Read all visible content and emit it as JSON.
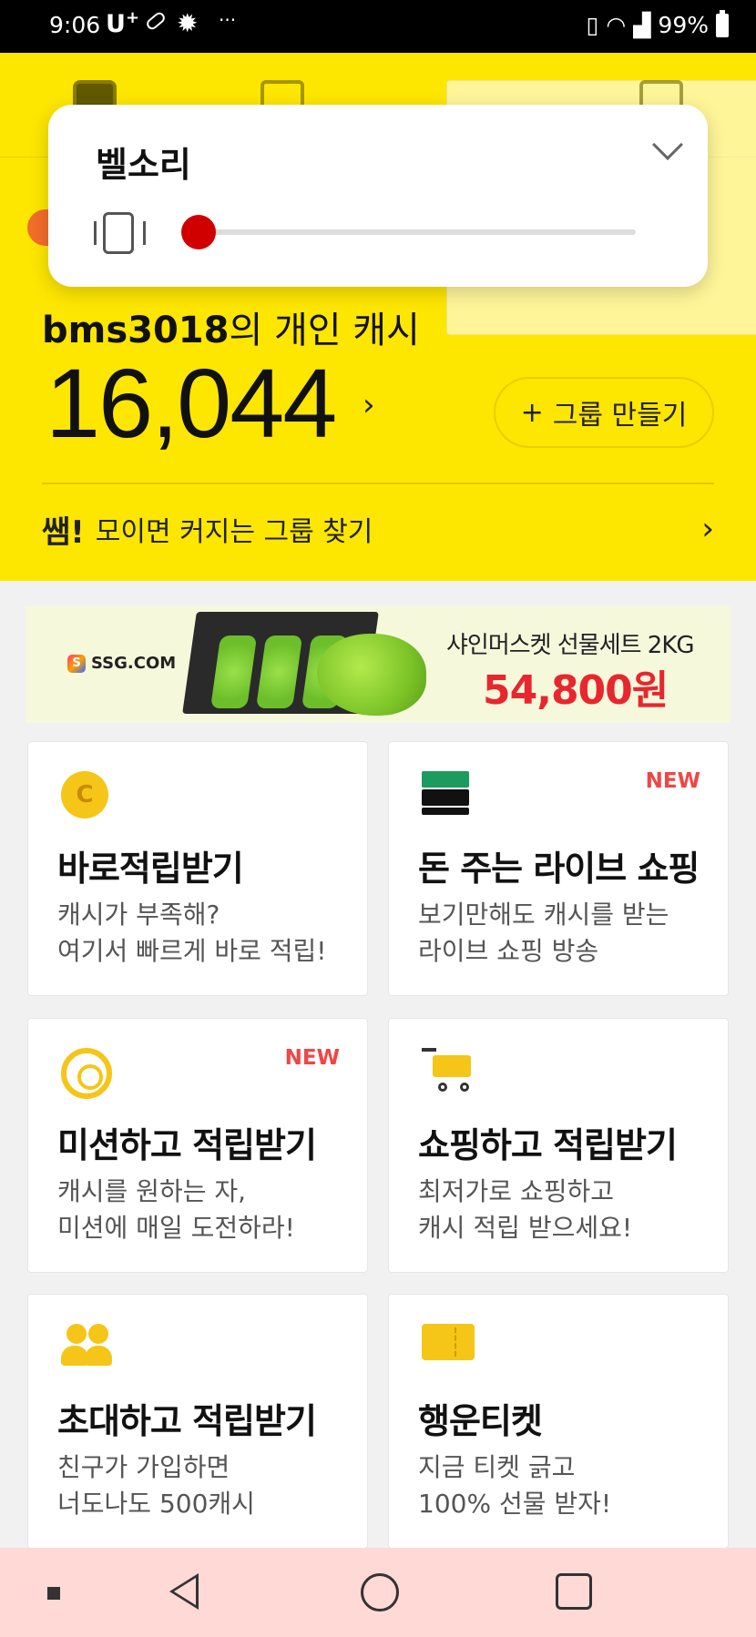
{
  "status_bar": {
    "time": "9:06",
    "carrier": "U",
    "carrier_sup": "+",
    "more": "···",
    "battery": "99%"
  },
  "tabs": [
    {
      "icon": "home-icon"
    },
    {
      "icon": "shopping-bag-icon"
    },
    {
      "icon": "card-icon"
    },
    {
      "icon": "settings-icon"
    }
  ],
  "volume_popup": {
    "title": "벨소리",
    "mode_icon": "vibrate-icon",
    "level": 0,
    "thumb_color": "#d00000"
  },
  "cash": {
    "user": "bms3018",
    "title_suffix": "의 개인 캐시",
    "amount": "16,044",
    "chevron": "›",
    "group_button_plus": "+",
    "group_button": "그룹 만들기"
  },
  "ssem": {
    "badge": "쌤!",
    "text": "모이면 커지는 그룹 찾기",
    "chevron": "›"
  },
  "banner": {
    "logo": "SSG.COM",
    "logo_mark": "S",
    "title": "샤인머스켓 선물세트 2KG",
    "price": "54,800원",
    "price_color": "#e8262e"
  },
  "cards": [
    {
      "title": "바로적립받기",
      "desc1": "캐시가 부족해?",
      "desc2": "여기서 빠르게 바로 적립!",
      "icon": "coin-icon",
      "icon_text": "C",
      "new": ""
    },
    {
      "title": "돈 주는 라이브 쇼핑",
      "desc1": "보기만해도 캐시를 받는",
      "desc2": "라이브 쇼핑 방송",
      "icon": "money-icon",
      "new": "NEW"
    },
    {
      "title": "미션하고 적립받기",
      "desc1": "캐시를 원하는 자,",
      "desc2": "미션에 매일 도전하라!",
      "icon": "target-icon",
      "new": "NEW"
    },
    {
      "title": "쇼핑하고 적립받기",
      "desc1": "최저가로 쇼핑하고",
      "desc2": "캐시 적립 받으세요!",
      "icon": "cart-icon",
      "new": ""
    },
    {
      "title": "초대하고 적립받기",
      "desc1": "친구가 가입하면",
      "desc2": "너도나도 500캐시",
      "icon": "people-icon",
      "new": ""
    },
    {
      "title": "행운티켓",
      "desc1": "지금 티켓 긁고",
      "desc2": "100% 선물 받자!",
      "icon": "ticket-icon",
      "new": ""
    }
  ],
  "colors": {
    "header_yellow": "#fde600",
    "accent_yellow": "#f5c518",
    "new_badge": "#f24545",
    "nav_bg": "#ffd9d6"
  }
}
